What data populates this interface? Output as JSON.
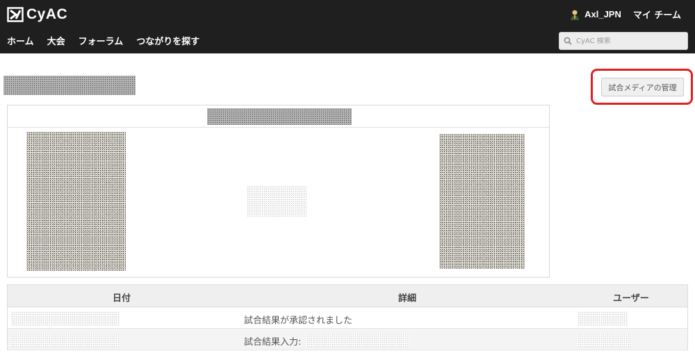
{
  "app": {
    "name": "CyAC"
  },
  "header": {
    "username": "Axl_JPN",
    "my_team": "マイ チーム",
    "nav": [
      "ホーム",
      "大会",
      "フォーラム",
      "つながりを探す"
    ],
    "search": {
      "placeholder": "CyAC 検索"
    }
  },
  "main": {
    "manage_media_button": "試合メディアの管理",
    "table": {
      "headers": {
        "date": "日付",
        "details": "詳細",
        "user": "ユーザー"
      },
      "rows": [
        {
          "detail": "試合結果が承認されました"
        },
        {
          "detail": "試合結果入力:"
        }
      ]
    }
  },
  "colors": {
    "header_bg": "#1f1f1f",
    "highlight": "#e41e1e"
  }
}
